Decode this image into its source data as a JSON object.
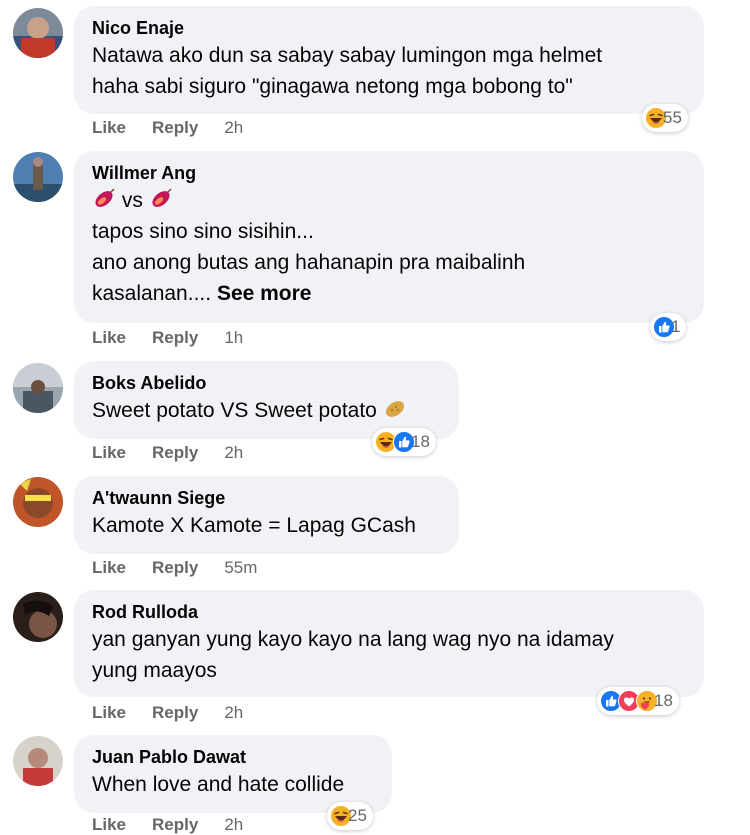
{
  "comments": [
    {
      "author": "Nico Enaje",
      "lines": [
        "Natawa ako dun sa sabay sabay lumingon mga helmet",
        "haha sabi siguro \"ginagawa netong mga bobong to\""
      ],
      "like": "Like",
      "reply": "Reply",
      "time": "2h",
      "reactions": {
        "icons": [
          "haha-icon"
        ],
        "count": "55"
      }
    },
    {
      "author": "Willmer Ang",
      "line_vs": "vs",
      "lines": [
        "tapos sino sino sisihin...",
        "ano anong butas ang hahanapin pra maibalinh"
      ],
      "last_line": "kasalanan....",
      "see_more": "See more",
      "like": "Like",
      "reply": "Reply",
      "time": "1h",
      "reactions": {
        "icons": [
          "like-icon"
        ],
        "count": "1"
      }
    },
    {
      "author": "Boks Abelido",
      "lines": [
        "Sweet potato VS Sweet potato"
      ],
      "like": "Like",
      "reply": "Reply",
      "time": "2h",
      "reactions": {
        "icons": [
          "haha-icon",
          "like-icon"
        ],
        "count": "18"
      }
    },
    {
      "author": "A'twaunn Siege",
      "lines": [
        "Kamote X Kamote = Lapag GCash"
      ],
      "like": "Like",
      "reply": "Reply",
      "time": "55m"
    },
    {
      "author": "Rod Rulloda",
      "lines": [
        "yan ganyan yung kayo kayo na lang wag nyo na idamay",
        "yung maayos"
      ],
      "like": "Like",
      "reply": "Reply",
      "time": "2h",
      "reactions": {
        "icons": [
          "like-icon",
          "love-icon",
          "care-icon"
        ],
        "count": "18"
      }
    },
    {
      "author": "Juan Pablo Dawat",
      "lines": [
        "When love and hate collide"
      ],
      "like": "Like",
      "reply": "Reply",
      "time": "2h",
      "reactions": {
        "icons": [
          "haha-icon"
        ],
        "count": "25"
      }
    }
  ],
  "colors": {
    "bubble": "#f0f2f5",
    "meta": "#65676b",
    "like_blue": "#1877f2",
    "haha_yellow": "#f7b125",
    "love_red": "#f33e58"
  }
}
